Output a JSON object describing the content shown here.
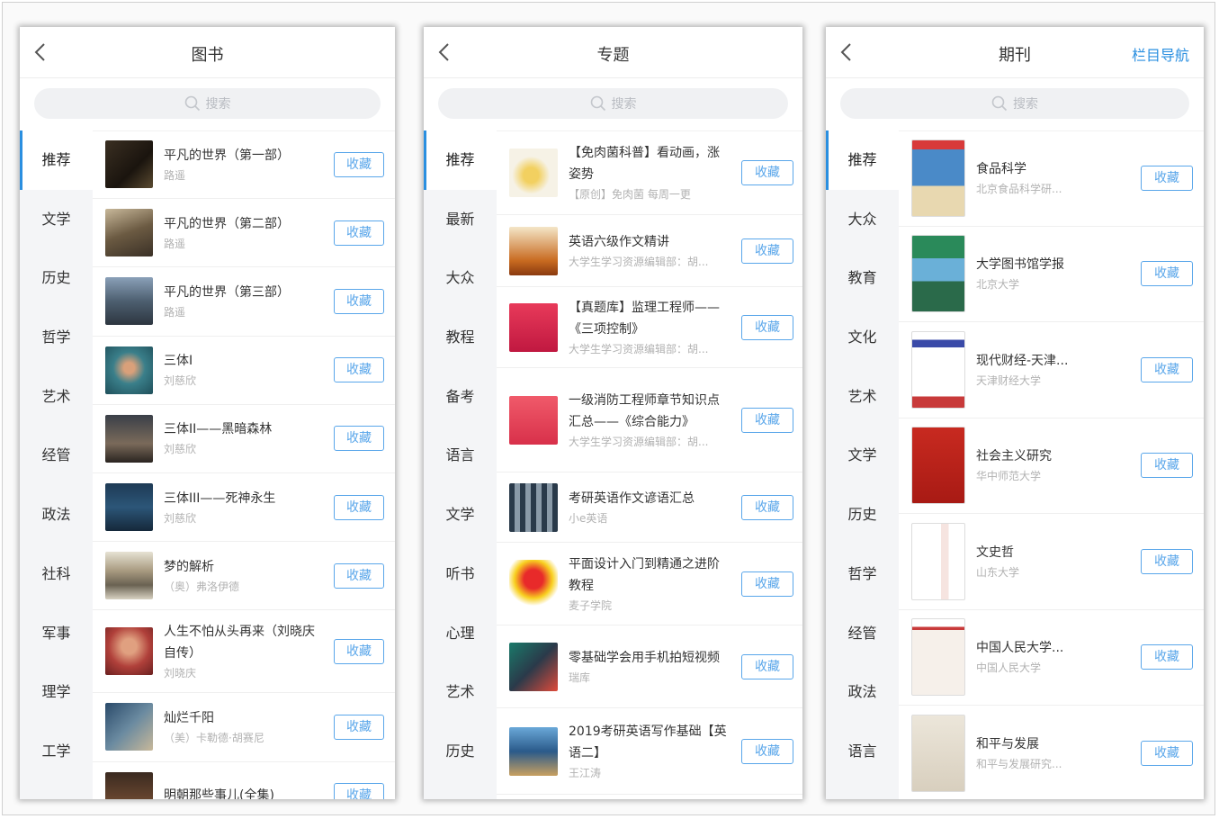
{
  "colors": {
    "accent": "#2a8fe0",
    "sidebar_bg": "#f4f5f7"
  },
  "panels": [
    {
      "title": "图书",
      "search_placeholder": "搜索",
      "categories": [
        "推荐",
        "文学",
        "历史",
        "哲学",
        "艺术",
        "经管",
        "政法",
        "社科",
        "军事",
        "理学",
        "工学"
      ],
      "items": [
        {
          "name": "平凡的世界（第一部）",
          "sub": "路遥",
          "button": "收藏"
        },
        {
          "name": "平凡的世界（第二部）",
          "sub": "路遥",
          "button": "收藏"
        },
        {
          "name": "平凡的世界（第三部）",
          "sub": "路遥",
          "button": "收藏"
        },
        {
          "name": "三体I",
          "sub": "刘慈欣",
          "button": "收藏"
        },
        {
          "name": "三体II——黑暗森林",
          "sub": "刘慈欣",
          "button": "收藏"
        },
        {
          "name": "三体III——死神永生",
          "sub": "刘慈欣",
          "button": "收藏"
        },
        {
          "name": "梦的解析",
          "sub": "（奥）弗洛伊德",
          "button": "收藏"
        },
        {
          "name": "人生不怕从头再来（刘晓庆自传）",
          "sub": "刘晓庆",
          "button": "收藏"
        },
        {
          "name": "灿烂千阳",
          "sub": "（美）卡勒德·胡赛尼",
          "button": "收藏"
        },
        {
          "name": "明朝那些事儿(全集)",
          "sub": "",
          "button": "收藏"
        }
      ]
    },
    {
      "title": "专题",
      "search_placeholder": "搜索",
      "categories": [
        "推荐",
        "最新",
        "大众",
        "教程",
        "备考",
        "语言",
        "文学",
        "听书",
        "心理",
        "艺术",
        "历史"
      ],
      "items": [
        {
          "name": "【免肉菌科普】看动画，涨姿势",
          "sub": "【原创】免肉菌 每周一更",
          "button": "收藏"
        },
        {
          "name": "英语六级作文精讲",
          "sub": "大学生学习资源编辑部：胡...",
          "button": "收藏"
        },
        {
          "name": "【真题库】监理工程师——《三项控制》",
          "sub": "大学生学习资源编辑部：胡...",
          "button": "收藏"
        },
        {
          "name": "一级消防工程师章节知识点汇总——《综合能力》",
          "sub": "大学生学习资源编辑部：胡...",
          "button": "收藏"
        },
        {
          "name": "考研英语作文谚语汇总",
          "sub": "小e英语",
          "button": "收藏"
        },
        {
          "name": "平面设计入门到精通之进阶教程",
          "sub": "麦子学院",
          "button": "收藏"
        },
        {
          "name": "零基础学会用手机拍短视频",
          "sub": "瑞库",
          "button": "收藏"
        },
        {
          "name": "2019考研英语写作基础【英语二】",
          "sub": "王江涛",
          "button": "收藏"
        }
      ]
    },
    {
      "title": "期刊",
      "nav_link": "栏目导航",
      "search_placeholder": "搜索",
      "categories": [
        "推荐",
        "大众",
        "教育",
        "文化",
        "艺术",
        "文学",
        "历史",
        "哲学",
        "经管",
        "政法",
        "语言"
      ],
      "items": [
        {
          "name": "食品科学",
          "sub": "北京食品科学研...",
          "button": "收藏"
        },
        {
          "name": "大学图书馆学报",
          "sub": "北京大学",
          "button": "收藏"
        },
        {
          "name": "现代财经-天津...",
          "sub": "天津财经大学",
          "button": "收藏"
        },
        {
          "name": "社会主义研究",
          "sub": "华中师范大学",
          "button": "收藏"
        },
        {
          "name": "文史哲",
          "sub": "山东大学",
          "button": "收藏"
        },
        {
          "name": "中国人民大学...",
          "sub": "中国人民大学",
          "button": "收藏"
        },
        {
          "name": "和平与发展",
          "sub": "和平与发展研究...",
          "button": "收藏"
        }
      ]
    }
  ]
}
